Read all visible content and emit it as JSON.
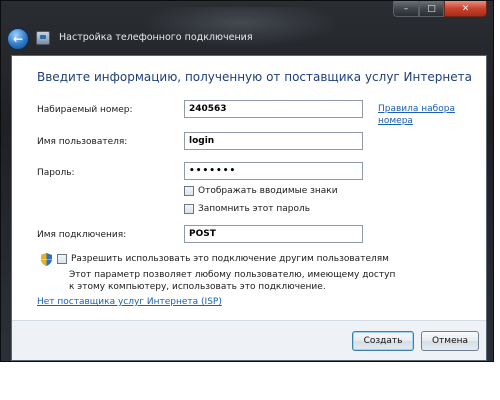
{
  "window": {
    "title": "Настройка телефонного подключения",
    "controls": {
      "minimize": "–",
      "maximize": "□",
      "close": "✕"
    },
    "back_icon": "back-arrow-icon"
  },
  "content": {
    "heading": "Введите информацию, полученную от поставщика услуг Интернета",
    "fields": {
      "phone": {
        "label": "Набираемый номер:",
        "value": "240563"
      },
      "username": {
        "label": "Имя пользователя:",
        "value": "login"
      },
      "password": {
        "label": "Пароль:",
        "value": "•••••••"
      },
      "connection_name": {
        "label": "Имя подключения:",
        "value": "POST"
      }
    },
    "dialing_rules_link": "Правила набора номера",
    "checkboxes": {
      "show_chars": {
        "label": "Отображать вводимые знаки",
        "checked": false
      },
      "remember_password": {
        "label": "Запомнить этот пароль",
        "checked": false
      },
      "allow_others": {
        "label": "Разрешить использовать это подключение другим пользователям",
        "checked": false
      }
    },
    "allow_others_desc": "Этот параметр позволяет любому пользователю, имеющему доступ к этому компьютеру, использовать это подключение.",
    "no_isp_link": "Нет поставщика услуг Интернета (ISP)"
  },
  "footer": {
    "create_button": "Создать",
    "cancel_button": "Отмена"
  },
  "colors": {
    "heading": "#1e3f7a",
    "link": "#1a5fb4",
    "titlebar": "#1e2024"
  }
}
